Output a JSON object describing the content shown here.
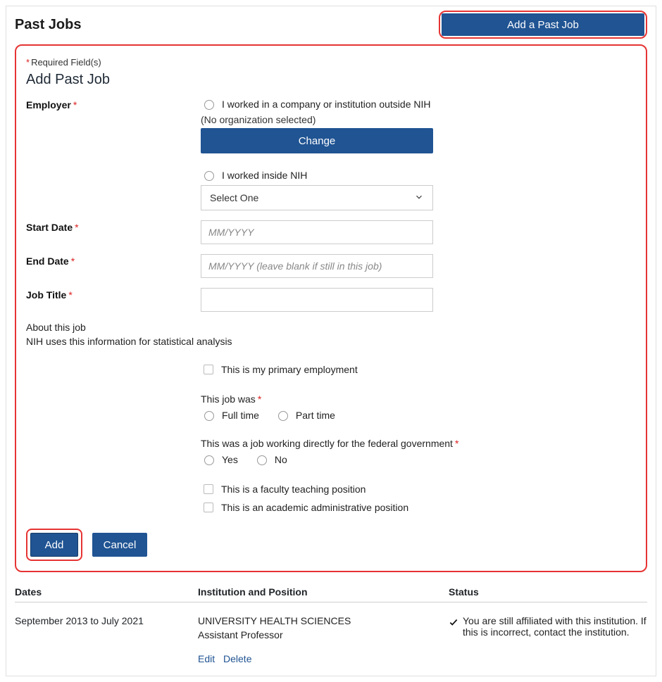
{
  "page_title": "Past Jobs",
  "header_button": "Add a Past Job",
  "required_label": "Required Field(s)",
  "form_title": "Add Past Job",
  "employer": {
    "label": "Employer",
    "outside_label": "I worked in a company or institution outside NIH",
    "no_org": "(No organization selected)",
    "change": "Change",
    "inside_label": "I worked inside NIH",
    "select_placeholder": "Select One"
  },
  "start_date": {
    "label": "Start Date",
    "placeholder": "MM/YYYY"
  },
  "end_date": {
    "label": "End Date",
    "placeholder": "MM/YYYY (leave blank if still in this job)"
  },
  "job_title": {
    "label": "Job Title"
  },
  "about": {
    "heading": "About this job",
    "sub": "NIH uses this information for statistical analysis",
    "primary_employment": "This is my primary employment",
    "job_was_label": "This job was",
    "fulltime": "Full time",
    "parttime": "Part time",
    "federal_label": "This was a job working directly for the federal government",
    "yes": "Yes",
    "no": "No",
    "faculty_teaching": "This is a faculty teaching position",
    "academic_admin": "This is an academic administrative position"
  },
  "actions": {
    "add": "Add",
    "cancel": "Cancel"
  },
  "table": {
    "headers": {
      "dates": "Dates",
      "inst": "Institution and Position",
      "status": "Status"
    },
    "row": {
      "dates": "September 2013 to July 2021",
      "institution": "UNIVERSITY HEALTH SCIENCES",
      "position": "Assistant Professor",
      "edit": "Edit",
      "delete": "Delete",
      "status": "You are still affiliated with this institution. If this is incorrect, contact the institution."
    }
  }
}
